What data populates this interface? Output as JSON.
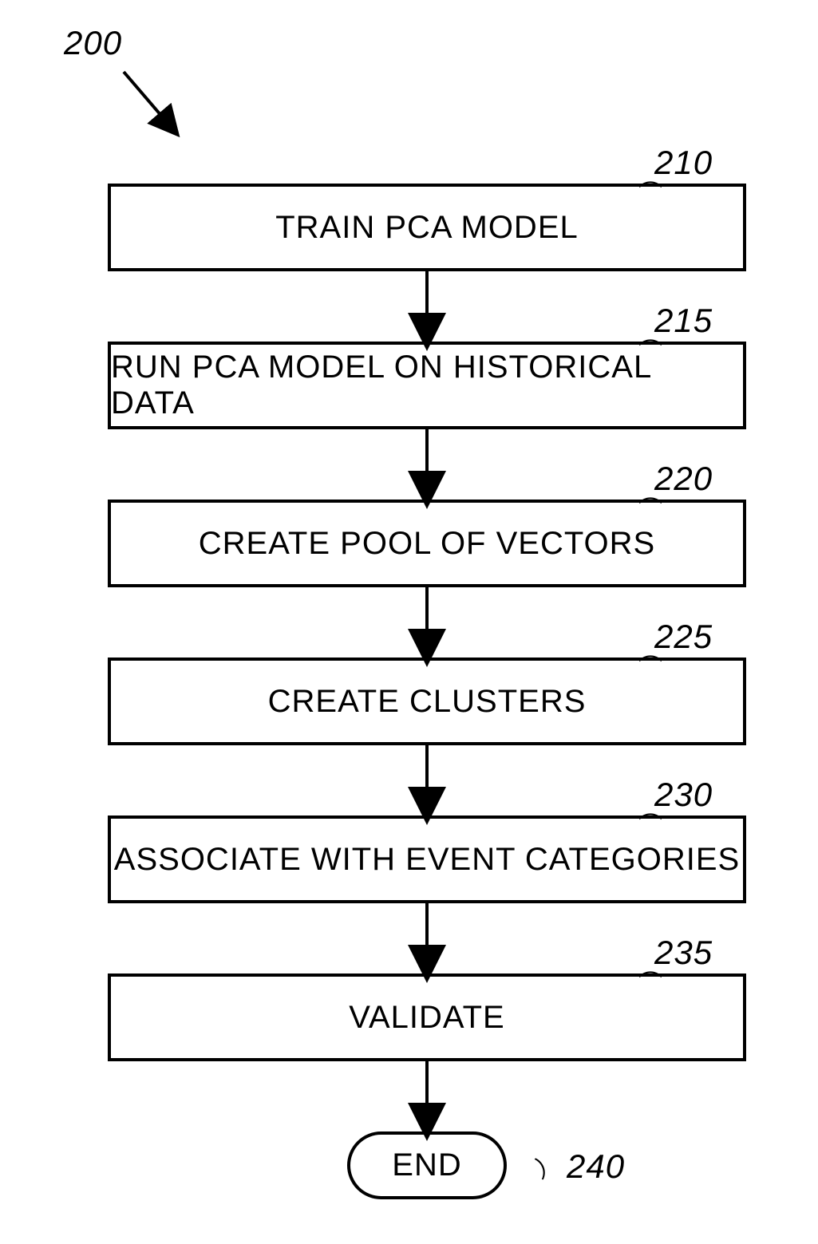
{
  "diagram": {
    "title_ref": "200",
    "steps": [
      {
        "ref": "210",
        "label": "TRAIN PCA MODEL"
      },
      {
        "ref": "215",
        "label": "RUN PCA MODEL ON HISTORICAL DATA"
      },
      {
        "ref": "220",
        "label": "CREATE POOL OF VECTORS"
      },
      {
        "ref": "225",
        "label": "CREATE CLUSTERS"
      },
      {
        "ref": "230",
        "label": "ASSOCIATE WITH EVENT CATEGORIES"
      },
      {
        "ref": "235",
        "label": "VALIDATE"
      }
    ],
    "end": {
      "ref": "240",
      "label": "END"
    }
  }
}
